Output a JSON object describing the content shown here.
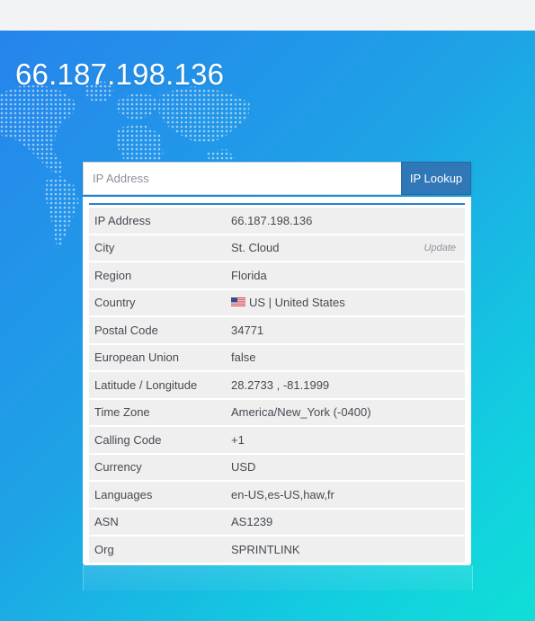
{
  "header": {
    "ip_title": "66.187.198.136"
  },
  "search": {
    "placeholder": "IP Address",
    "button_label": "IP Lookup"
  },
  "details": {
    "update_label": "Update",
    "rows": [
      {
        "label": "IP Address",
        "value": "66.187.198.136"
      },
      {
        "label": "City",
        "value": "St. Cloud"
      },
      {
        "label": "Region",
        "value": "Florida"
      },
      {
        "label": "Country",
        "value": "US | United States",
        "icon": "us-flag-icon"
      },
      {
        "label": "Postal Code",
        "value": "34771"
      },
      {
        "label": "European Union",
        "value": "false"
      },
      {
        "label": "Latitude / Longitude",
        "value": "28.2733 , -81.1999"
      },
      {
        "label": "Time Zone",
        "value": "America/New_York (-0400)"
      },
      {
        "label": "Calling Code",
        "value": "+1"
      },
      {
        "label": "Currency",
        "value": "USD"
      },
      {
        "label": "Languages",
        "value": "en-US,es-US,haw,fr"
      },
      {
        "label": "ASN",
        "value": "AS1239"
      },
      {
        "label": "Org",
        "value": "SPRINTLINK"
      }
    ]
  },
  "colors": {
    "gradient_start": "#2684ec",
    "gradient_end": "#10dfd6",
    "button": "#3077b8",
    "row_background": "#efefef"
  }
}
